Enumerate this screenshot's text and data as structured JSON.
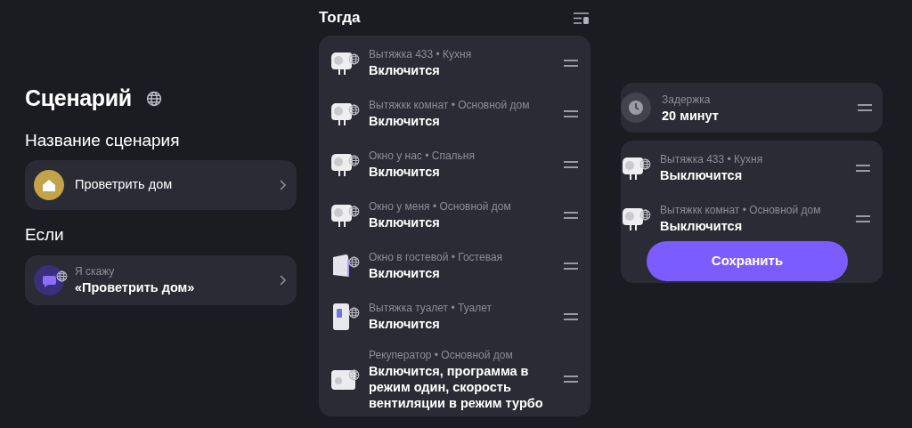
{
  "title": "Сценарий",
  "name_section": {
    "label": "Название сценария",
    "value": "Проветрить дом"
  },
  "trigger_section": {
    "label": "Если",
    "caption": "Я скажу",
    "value": "«Проветрить дом»"
  },
  "then_section": {
    "label": "Тогда",
    "actions": [
      {
        "kind": "plug",
        "device": "Вытяжка 433 • Кухня",
        "action": "Включится"
      },
      {
        "kind": "plug",
        "device": "Вытяжкк комнат • Основной дом",
        "action": "Включится"
      },
      {
        "kind": "plug",
        "device": "Окно у нас • Спальня",
        "action": "Включится"
      },
      {
        "kind": "plug",
        "device": "Окно у меня • Основной дом",
        "action": "Включится"
      },
      {
        "kind": "purifier",
        "device": "Окно в гостевой • Гостевая",
        "action": "Включится"
      },
      {
        "kind": "heater",
        "device": "Вытяжка туалет • Туалет",
        "action": "Включится"
      },
      {
        "kind": "recuperator",
        "device": "Рекуператор • Основной дом",
        "action": "Включится, программа в режим один, скорость вентиляции в режим турбо"
      }
    ]
  },
  "delay": {
    "caption": "Задержка",
    "value": "20 минут",
    "actions": [
      {
        "kind": "plug",
        "device": "Вытяжка 433 • Кухня",
        "action": "Выключится"
      },
      {
        "kind": "plug",
        "device": "Вытяжкк комнат • Основной дом",
        "action": "Выключится"
      }
    ]
  },
  "save_button": "Сохранить"
}
